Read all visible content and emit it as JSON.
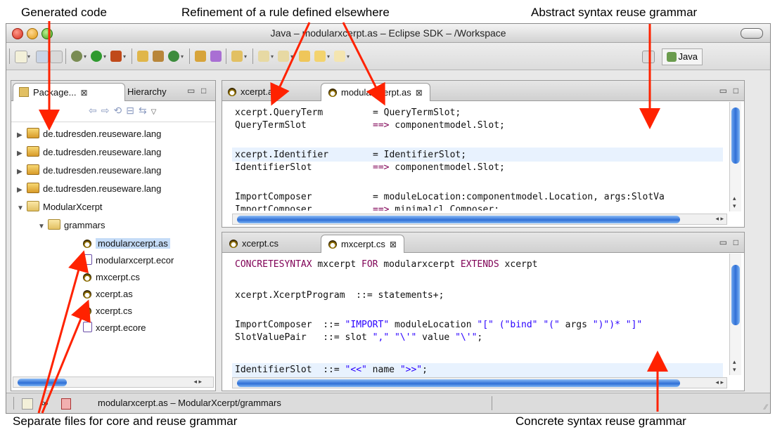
{
  "annotations": {
    "generated_code": "Generated code",
    "refinement": "Refinement of a rule defined elsewhere",
    "abstract_reuse": "Abstract syntax reuse grammar",
    "separate_files": "Separate files for core and reuse grammar",
    "concrete_reuse": "Concrete syntax reuse grammar"
  },
  "window": {
    "title": "Java – modularxcerpt.as – Eclipse SDK – /Workspace"
  },
  "toolbar": {
    "perspective_label": "Java"
  },
  "package_view": {
    "tab_package": "Package...",
    "tab_hierarchy": "Hierarchy",
    "tree": [
      {
        "label": "de.tudresden.reuseware.lang"
      },
      {
        "label": "de.tudresden.reuseware.lang"
      },
      {
        "label": "de.tudresden.reuseware.lang"
      },
      {
        "label": "de.tudresden.reuseware.lang"
      },
      {
        "label": "ModularXcerpt"
      },
      {
        "label": "grammars"
      },
      {
        "label": "modularxcerpt.as"
      },
      {
        "label": "modularxcerpt.ecor"
      },
      {
        "label": "mxcerpt.cs"
      },
      {
        "label": "xcerpt.as"
      },
      {
        "label": "xcerpt.cs"
      },
      {
        "label": "xcerpt.ecore"
      }
    ]
  },
  "editor_top": {
    "tab1": "xcerpt.as",
    "tab2": "modularxcerpt.as",
    "lines": [
      [
        "xcerpt.QueryTerm",
        "= QueryTermSlot;"
      ],
      [
        "QueryTermSlot",
        "==> componentmodel.Slot;"
      ],
      [
        "",
        ""
      ],
      [
        "xcerpt.Identifier",
        "= IdentifierSlot;"
      ],
      [
        "IdentifierSlot",
        "==> componentmodel.Slot;"
      ],
      [
        "",
        ""
      ],
      [
        "ImportComposer",
        "= moduleLocation:componentmodel.Location, args:SlotVa"
      ],
      [
        "ImportComposer",
        "==> minimalcl.Composer;"
      ]
    ]
  },
  "editor_bottom": {
    "tab1": "xcerpt.cs",
    "tab2": "mxcerpt.cs",
    "line1_kw": "CONCRETESYNTAX",
    "line1_a": " mxcerpt ",
    "line1_kw2": "FOR",
    "line1_b": " modularxcerpt ",
    "line1_kw3": "EXTENDS",
    "line1_c": " xcerpt",
    "line2": "xcerpt.XcerptProgram  ::= statements+;",
    "line3_a": "ImportComposer  ::= ",
    "line3_s1": "\"IMPORT\"",
    "line3_b": " moduleLocation ",
    "line3_s2": "\"[\" (\"bind\" \"(\" ",
    "line3_c": "args ",
    "line3_s3": "\")\")* \"]\"",
    "line4_a": "SlotValuePair   ::= slot ",
    "line4_s1": "\",\" \"\\'\"",
    "line4_b": " value ",
    "line4_s2": "\"\\'\"",
    "line4_c": ";",
    "line5_a": "IdentifierSlot  ::= ",
    "line5_s1": "\"<<\"",
    "line5_b": " name ",
    "line5_s2": "\">>\"",
    "line5_c": ";"
  },
  "status": {
    "text": "modularxcerpt.as – ModularXcerpt/grammars"
  },
  "colors": {
    "selection": "#c5dcf7",
    "keyword": "#7f0055",
    "string": "#2a00ff",
    "annotation_arrow": "#ff2200"
  }
}
